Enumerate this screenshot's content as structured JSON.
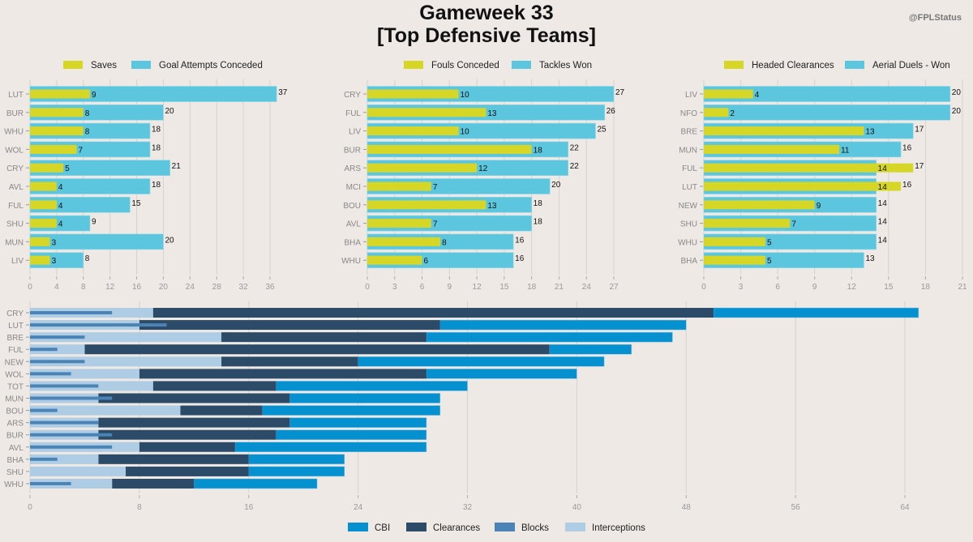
{
  "header": {
    "title_line1": "Gameweek 33",
    "title_line2": "[Top Defensive Teams]",
    "handle": "@FPLStatus"
  },
  "colors": {
    "background": "#eee9e5",
    "yellow": "#d6d626",
    "cyan": "#5bc6dd",
    "cbi": "#0590cf",
    "clearances": "#2c4b68",
    "blocks": "#4a84b6",
    "interceptions": "#aecce4",
    "grid": "#d6d2cf"
  },
  "chart_data": [
    {
      "type": "bar",
      "orientation": "horizontal",
      "overlay": true,
      "categories": [
        "LUT",
        "BUR",
        "WHU",
        "WOL",
        "CRY",
        "AVL",
        "FUL",
        "SHU",
        "MUN",
        "LIV"
      ],
      "series": [
        {
          "name": "Goal Attempts Conceded",
          "color": "cyan",
          "values": [
            37,
            20,
            18,
            18,
            21,
            18,
            15,
            9,
            20,
            8
          ]
        },
        {
          "name": "Saves",
          "color": "yellow",
          "values": [
            9,
            8,
            8,
            7,
            5,
            4,
            4,
            4,
            3,
            3
          ]
        }
      ],
      "legend": [
        "Saves",
        "Goal Attempts Conceded"
      ],
      "legend_placement": "top",
      "xlim": [
        0,
        37
      ],
      "xticks": [
        0,
        4,
        8,
        12,
        16,
        20,
        24,
        28,
        32,
        36
      ],
      "grid": true
    },
    {
      "type": "bar",
      "orientation": "horizontal",
      "overlay": true,
      "categories": [
        "CRY",
        "FUL",
        "LIV",
        "BUR",
        "ARS",
        "MCI",
        "BOU",
        "AVL",
        "BHA",
        "WHU"
      ],
      "series": [
        {
          "name": "Tackles Won",
          "color": "cyan",
          "values": [
            27,
            26,
            25,
            22,
            22,
            20,
            18,
            18,
            16,
            16
          ]
        },
        {
          "name": "Fouls Conceded",
          "color": "yellow",
          "values": [
            10,
            13,
            10,
            18,
            12,
            7,
            13,
            7,
            8,
            6
          ]
        }
      ],
      "legend": [
        "Fouls Conceded",
        "Tackles Won"
      ],
      "legend_placement": "top",
      "xlim": [
        0,
        27
      ],
      "xticks": [
        0,
        3,
        6,
        9,
        12,
        15,
        18,
        21,
        24,
        27
      ],
      "grid": true
    },
    {
      "type": "bar",
      "orientation": "horizontal",
      "overlay": true,
      "categories": [
        "LIV",
        "NFO",
        "BRE",
        "MUN",
        "FUL",
        "LUT",
        "NEW",
        "SHU",
        "WHU",
        "BHA"
      ],
      "series": [
        {
          "name": "Aerial Duels - Won",
          "color": "cyan",
          "values": [
            20,
            20,
            17,
            16,
            14,
            14,
            14,
            14,
            14,
            13
          ]
        },
        {
          "name": "Headed Clearances",
          "color": "yellow",
          "values": [
            4,
            2,
            13,
            11,
            17,
            16,
            9,
            7,
            5,
            5
          ]
        }
      ],
      "value_labels": [
        [
          "4",
          "20"
        ],
        [
          "2",
          "20"
        ],
        [
          "13",
          "17"
        ],
        [
          "11",
          "16"
        ],
        [
          "14",
          "17"
        ],
        [
          "14",
          "16"
        ],
        [
          "9",
          "14"
        ],
        [
          "7",
          "14"
        ],
        [
          "5",
          "14"
        ],
        [
          "5",
          "13"
        ]
      ],
      "legend": [
        "Headed Clearances",
        "Aerial Duels - Won"
      ],
      "legend_placement": "top",
      "xlim": [
        0,
        21
      ],
      "xticks": [
        0,
        3,
        6,
        9,
        12,
        15,
        18,
        21
      ],
      "grid": true
    },
    {
      "type": "bar",
      "orientation": "horizontal",
      "stacked": true,
      "categories": [
        "CRY",
        "LUT",
        "BRE",
        "FUL",
        "NEW",
        "WOL",
        "TOT",
        "MUN",
        "BOU",
        "ARS",
        "BUR",
        "AVL",
        "BHA",
        "SHU",
        "WHU"
      ],
      "series": [
        {
          "name": "Interceptions",
          "color": "interceptions",
          "values": [
            9,
            8,
            14,
            4,
            14,
            8,
            9,
            5,
            11,
            5,
            5,
            8,
            5,
            7,
            6
          ]
        },
        {
          "name": "Clearances",
          "color": "clearances",
          "cumulative_end": [
            50,
            30,
            29,
            38,
            24,
            29,
            18,
            19,
            17,
            19,
            18,
            15,
            16,
            16,
            12
          ]
        },
        {
          "name": "CBI",
          "color": "cbi",
          "total": [
            65,
            48,
            47,
            44,
            42,
            40,
            32,
            30,
            30,
            29,
            29,
            29,
            23,
            23,
            21
          ]
        },
        {
          "name": "Blocks",
          "color": "blocks",
          "values": [
            6,
            10,
            4,
            2,
            4,
            3,
            5,
            6,
            2,
            5,
            6,
            6,
            2,
            0,
            3
          ]
        }
      ],
      "legend": [
        "CBI",
        "Clearances",
        "Blocks",
        "Interceptions"
      ],
      "legend_placement": "bottom",
      "xlim": [
        0,
        68
      ],
      "xticks": [
        0,
        8,
        16,
        24,
        32,
        40,
        48,
        56,
        64
      ],
      "grid": true
    }
  ]
}
